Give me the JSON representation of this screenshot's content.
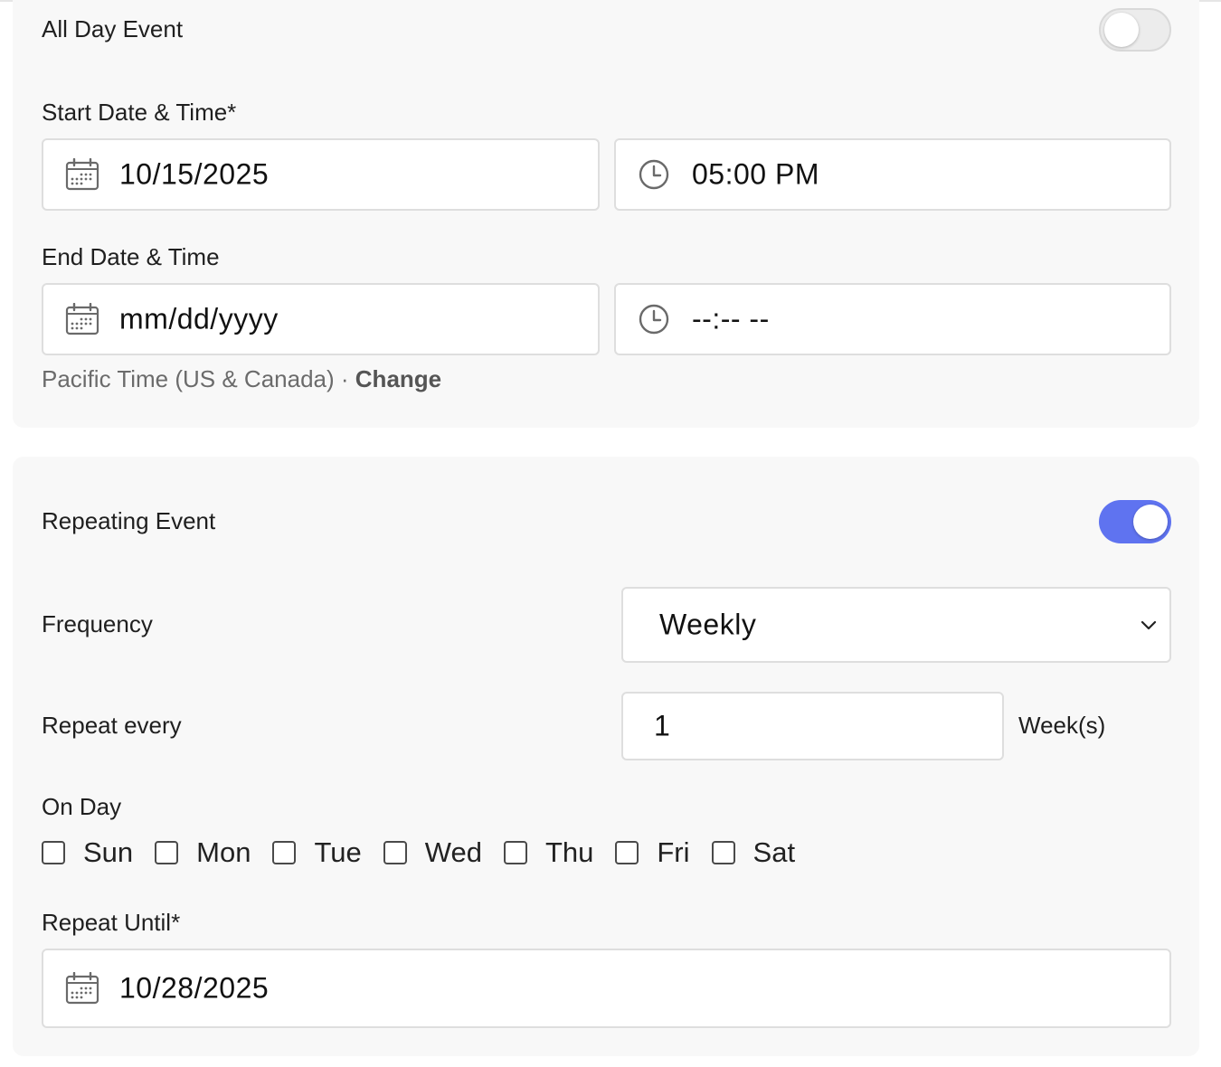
{
  "all_day": {
    "label": "All Day Event",
    "enabled": false
  },
  "start": {
    "label": "Start Date & Time*",
    "date_value": "10/15/2025",
    "time_value": "05:00 PM"
  },
  "end": {
    "label": "End Date & Time",
    "date_placeholder": "mm/dd/yyyy",
    "time_placeholder": "--:-- --"
  },
  "timezone": {
    "text": "Pacific Time (US & Canada)",
    "separator": " · ",
    "change_label": "Change"
  },
  "repeating": {
    "label": "Repeating Event",
    "enabled": true
  },
  "frequency": {
    "label": "Frequency",
    "selected": "Weekly"
  },
  "repeat_every": {
    "label": "Repeat every",
    "value": "1",
    "unit": "Week(s)"
  },
  "on_day": {
    "label": "On Day",
    "days": [
      {
        "label": "Sun",
        "checked": false
      },
      {
        "label": "Mon",
        "checked": false
      },
      {
        "label": "Tue",
        "checked": false
      },
      {
        "label": "Wed",
        "checked": false
      },
      {
        "label": "Thu",
        "checked": false
      },
      {
        "label": "Fri",
        "checked": false
      },
      {
        "label": "Sat",
        "checked": false
      }
    ]
  },
  "repeat_until": {
    "label": "Repeat Until*",
    "date_value": "10/28/2025"
  },
  "icons": {
    "date": "calendar-icon",
    "time": "clock-icon",
    "select": "chevron-down-icon"
  },
  "colors": {
    "toggle_on": "#5f73f0",
    "card_bg": "#f8f8f8"
  }
}
